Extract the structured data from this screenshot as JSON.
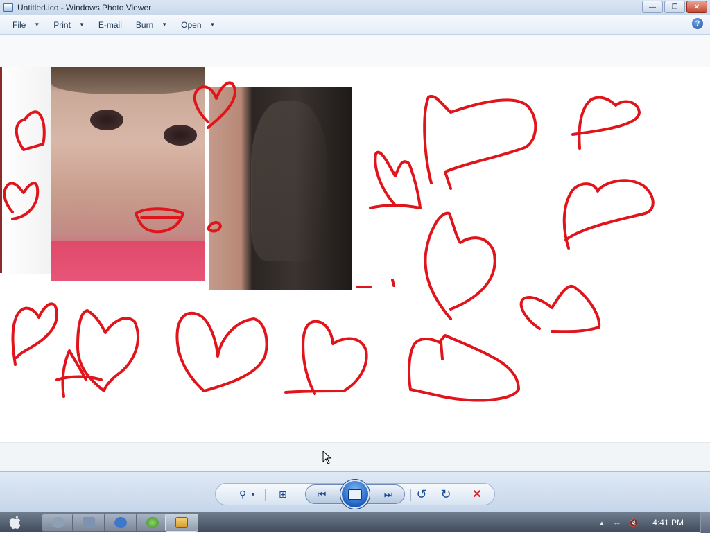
{
  "window": {
    "title": "Untitled.ico - Windows Photo Viewer",
    "minimize_label": "—",
    "restore_label": "❐",
    "close_label": "✕"
  },
  "menu": {
    "items": [
      {
        "label": "File"
      },
      {
        "label": "Print"
      },
      {
        "label": "E-mail"
      },
      {
        "label": "Burn"
      },
      {
        "label": "Open"
      }
    ],
    "dropdown_glyph": "▼",
    "help_label": "?"
  },
  "controls": {
    "zoom_glyph": "⚲",
    "actual_size_glyph": "⊞",
    "previous_glyph": "⏮",
    "next_glyph": "⏭",
    "rotate_ccw_glyph": "↺",
    "rotate_cw_glyph": "↻",
    "delete_glyph": "✕",
    "colors": {
      "delete": "#d8232a",
      "accent": "#1d5fc0"
    }
  },
  "taskbar": {
    "start_glyph": "",
    "buttons": [
      {
        "name": "disk-utility",
        "color": "#8fa0b5"
      },
      {
        "name": "file-explorer",
        "color": "#7e93b0"
      },
      {
        "name": "internet-explorer",
        "color": "#3f78c9"
      },
      {
        "name": "media-player",
        "color": "#5aa04a"
      },
      {
        "name": "photo-viewer",
        "color": "#e3b23c"
      }
    ],
    "tray": {
      "show_hidden_glyph": "▲",
      "network_glyph": "⇔",
      "volume_glyph": "🔇",
      "clock": "4:41 PM"
    }
  },
  "image": {
    "description_colors": {
      "ink": "#e0141b"
    }
  }
}
